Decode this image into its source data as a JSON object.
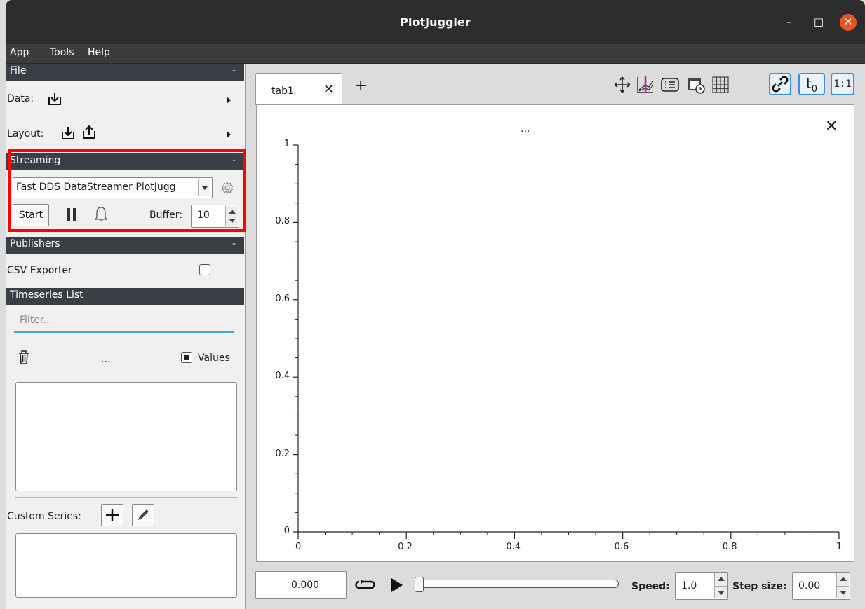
{
  "window": {
    "title": "PlotJuggler",
    "minimize": "–",
    "maximize": "□",
    "close": "✕"
  },
  "menubar": {
    "items": [
      "App",
      "Tools",
      "Help"
    ]
  },
  "sidebar": {
    "file": {
      "header": "File",
      "collapse": "-",
      "data_label": "Data:",
      "layout_label": "Layout:"
    },
    "streaming": {
      "header": "Streaming",
      "collapse": "-",
      "plugin": "Fast DDS DataStreamer PlotJugg",
      "start": "Start",
      "buffer_label": "Buffer:",
      "buffer_value": "10"
    },
    "publishers": {
      "header": "Publishers",
      "collapse": "-",
      "csv_exporter": "CSV Exporter"
    },
    "timeseries": {
      "header": "Timeseries List",
      "filter_placeholder": "Filter...",
      "dots": "...",
      "values_label": "Values",
      "custom_series_label": "Custom Series:"
    }
  },
  "tabs": [
    {
      "label": "tab1",
      "close": "✕"
    }
  ],
  "add_tab": "+",
  "toolbar": {
    "icons": [
      "move-icon",
      "zoom-fit-icon",
      "legend-icon",
      "time-icon",
      "grid-icon",
      "link-icon",
      "t0-icon",
      "ratio-icon"
    ],
    "t0": "t",
    "t0_sub": "0",
    "ratio": "1:1"
  },
  "plot": {
    "title": "...",
    "close": "✕",
    "y_ticks": [
      "1",
      "0.8",
      "0.6",
      "0.4",
      "0.2",
      "0"
    ],
    "x_ticks": [
      "0",
      "0.2",
      "0.4",
      "0.6",
      "0.8",
      "1"
    ]
  },
  "bottom": {
    "time": "0.000",
    "speed_label": "Speed:",
    "speed_value": "1.0",
    "step_label": "Step size:",
    "step_value": "0.00"
  },
  "colors": {
    "accent": "#3a8fdc",
    "highlight": "#ff0000",
    "header_bg": "#3a3f46",
    "close_btn": "#e95420"
  }
}
